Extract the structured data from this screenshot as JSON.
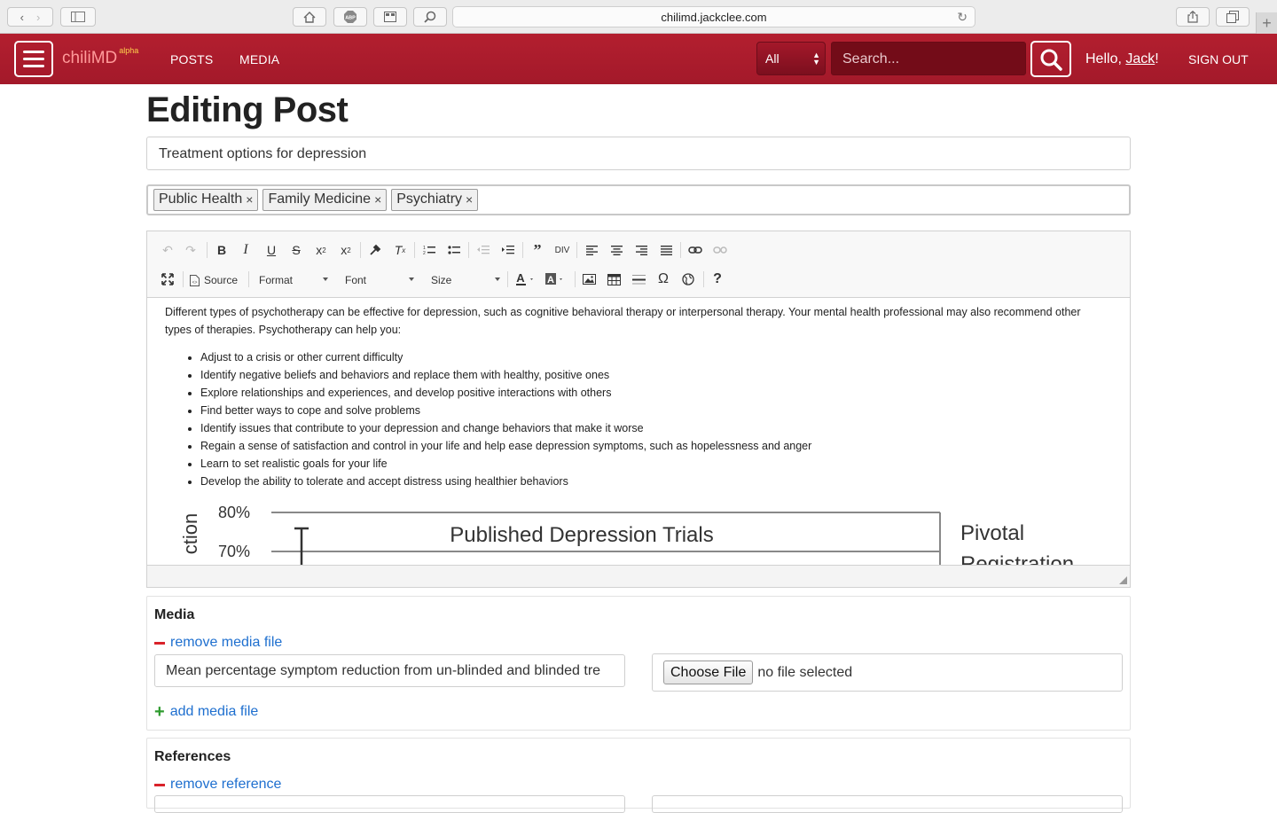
{
  "browser": {
    "url": "chilimd.jackclee.com"
  },
  "nav": {
    "brand": "chiliMD",
    "brand_sup": "alpha",
    "links": [
      "POSTS",
      "MEDIA"
    ],
    "search_scope": "All",
    "search_placeholder": "Search...",
    "greeting_prefix": "Hello, ",
    "username": "Jack",
    "greeting_suffix": "!",
    "signout": "SIGN OUT"
  },
  "page": {
    "title": "Editing Post",
    "post_title_value": "Treatment options for depression",
    "tags": [
      "Public Health",
      "Family Medicine",
      "Psychiatry"
    ]
  },
  "editor": {
    "toolbar": {
      "source_label": "Source",
      "format_label": "Format",
      "font_label": "Font",
      "size_label": "Size"
    },
    "paragraph": "Different types of psychotherapy can be effective for depression, such as cognitive behavioral therapy or interpersonal therapy. Your mental health professional may also recommend other types of therapies. Psychotherapy can help you:",
    "bullets": [
      "Adjust to a crisis or other current difficulty",
      "Identify negative beliefs and behaviors and replace them with healthy, positive ones",
      "Explore relationships and experiences, and develop positive interactions with others",
      "Find better ways to cope and solve problems",
      "Identify issues that contribute to your depression and change behaviors that make it worse",
      "Regain a sense of satisfaction and control in your life and help ease depression symptoms, such as hopelessness and anger",
      "Learn to set realistic goals for your life",
      "Develop the ability to tolerate and accept distress using healthier behaviors"
    ],
    "embedded_chart": {
      "title": "Published Depression Trials",
      "y_label_fragment": "ction",
      "ticks": [
        "80%",
        "70%"
      ],
      "side_label_1": "Pivotal",
      "side_label_2": "Registration"
    }
  },
  "media": {
    "heading": "Media",
    "remove_label": "remove media file",
    "caption_value": "Mean percentage symptom reduction from un-blinded and blinded tre",
    "choose_file": "Choose File",
    "no_file": "no file selected",
    "add_label": "add media file"
  },
  "references": {
    "heading": "References",
    "remove_label": "remove reference"
  }
}
